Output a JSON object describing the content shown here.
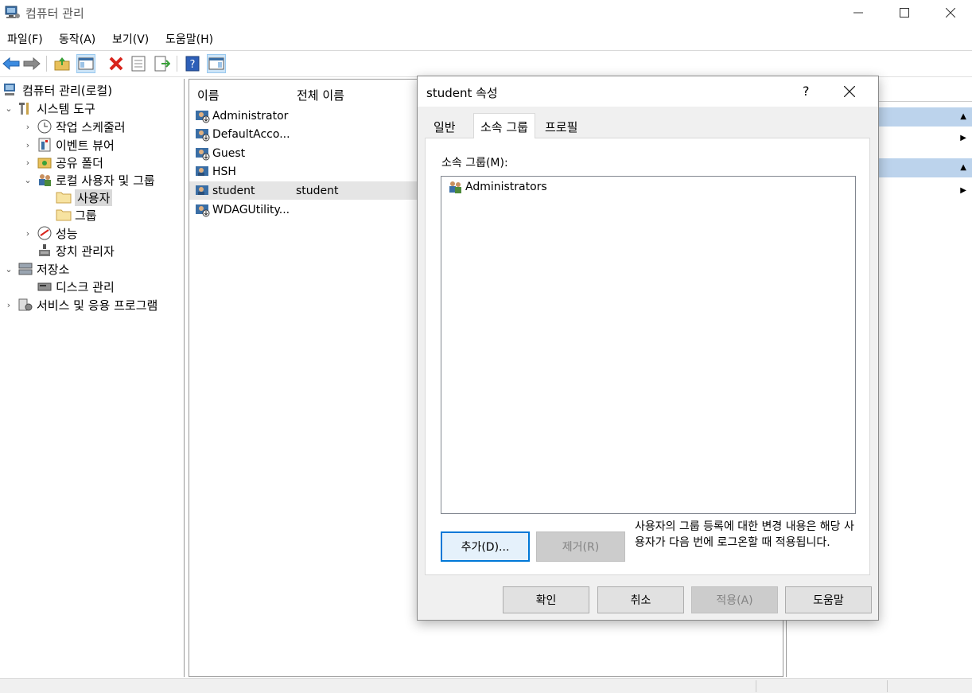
{
  "window": {
    "title": "컴퓨터 관리"
  },
  "menu": [
    "파일(F)",
    "동작(A)",
    "보기(V)",
    "도움말(H)"
  ],
  "tree": {
    "root": "컴퓨터 관리(로컬)",
    "system_tools": "시스템 도구",
    "task_scheduler": "작업 스케줄러",
    "event_viewer": "이벤트 뷰어",
    "shared_folders": "공유 폴더",
    "local_users_groups": "로컬 사용자 및 그룹",
    "users": "사용자",
    "groups": "그룹",
    "performance": "성능",
    "device_manager": "장치 관리자",
    "storage": "저장소",
    "disk_management": "디스크 관리",
    "services_apps": "서비스 및 응용 프로그램"
  },
  "list": {
    "columns": [
      "이름",
      "전체 이름"
    ],
    "rows": [
      {
        "name": "Administrator",
        "full": ""
      },
      {
        "name": "DefaultAcco...",
        "full": ""
      },
      {
        "name": "Guest",
        "full": ""
      },
      {
        "name": "HSH",
        "full": ""
      },
      {
        "name": "student",
        "full": "student"
      },
      {
        "name": "WDAGUtility...",
        "full": ""
      }
    ]
  },
  "dialog": {
    "title": "student 속성",
    "help_glyph": "?",
    "tabs": [
      "일반",
      "소속 그룹",
      "프로필"
    ],
    "group_label": "소속 그룹(M):",
    "groups": [
      "Administrators"
    ],
    "add_button": "추가(D)...",
    "remove_button": "제거(R)",
    "note": "사용자의 그룹 등록에 대한 변경 내용은 해당 사용자가 다음 번에 로그온할 때 적용됩니다.",
    "ok_button": "확인",
    "cancel_button": "취소",
    "apply_button": "적용(A)",
    "help_button": "도움말"
  },
  "colors": {
    "accent": "#0078d7",
    "action_header": "#bcd3ec"
  }
}
